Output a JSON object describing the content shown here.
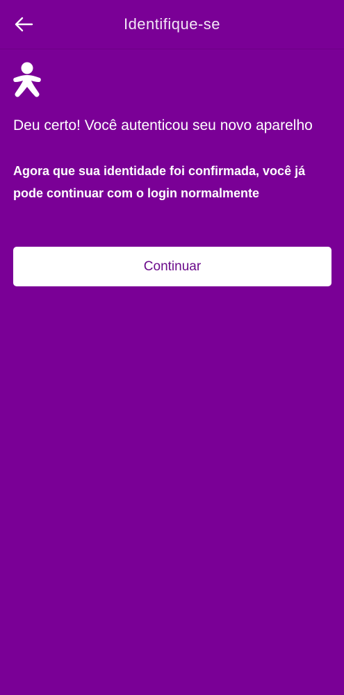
{
  "header": {
    "title": "Identifique-se",
    "back_icon": "arrow-left-icon"
  },
  "brand": {
    "logo_icon": "vivo-person-logo-icon"
  },
  "message": {
    "title": "Deu certo! Você autenticou seu novo aparelho",
    "body": "Agora que sua identidade foi confirmada, você já pode continuar com o login normalmente"
  },
  "actions": {
    "continue_label": "Continuar"
  },
  "colors": {
    "background": "#7a0096",
    "button_bg": "#ffffff",
    "button_text": "#6a0a8a"
  }
}
